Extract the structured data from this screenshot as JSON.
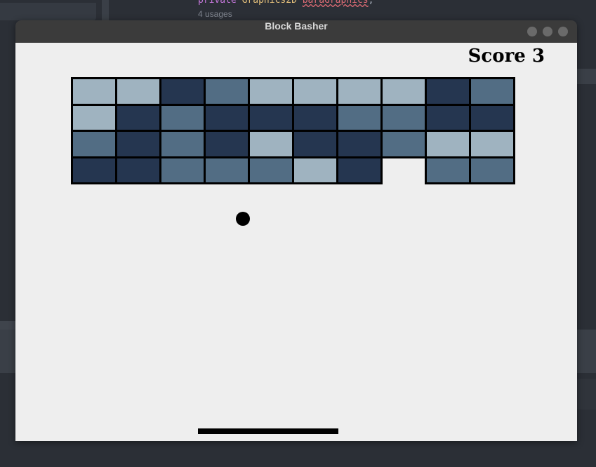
{
  "background": {
    "code_line": [
      "private",
      " Graphics2D ",
      "baraGraphics",
      ";"
    ],
    "usages": "4 usages"
  },
  "window": {
    "title": "Block Basher",
    "controls": [
      "minimize",
      "maximize",
      "close"
    ]
  },
  "game": {
    "score_label": "Score 3",
    "score": 3,
    "colors": {
      "L": "#9fb3c0",
      "M": "#526d84",
      "D": "#253650",
      "background": "#eeeeee"
    },
    "bricks": [
      [
        "L",
        "L",
        "D",
        "M",
        "L",
        "L",
        "L",
        "L",
        "D",
        "M"
      ],
      [
        "L",
        "D",
        "M",
        "D",
        "D",
        "D",
        "M",
        "M",
        "D",
        "D"
      ],
      [
        "M",
        "D",
        "M",
        "D",
        "L",
        "D",
        "D",
        "M",
        "L",
        "L"
      ],
      [
        "D",
        "D",
        "M",
        "M",
        "M",
        "L",
        "D",
        null,
        "M",
        "M"
      ]
    ]
  }
}
